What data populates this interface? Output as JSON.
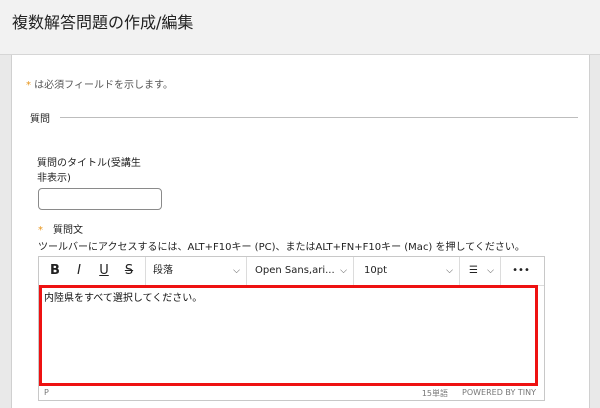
{
  "page": {
    "title": "複数解答問題の作成/編集"
  },
  "required_note": {
    "star": "*",
    "text": " は必須フィールドを示します。"
  },
  "section": {
    "label": "質問"
  },
  "title_field": {
    "label_line1": "質問のタイトル(受講生",
    "label_line2": "非表示)",
    "value": ""
  },
  "question": {
    "star": "*",
    "label": "質問文",
    "hint": "ツールバーにアクセスするには、ALT+F10キー (PC)、またはALT+FN+F10キー (Mac) を押してください。"
  },
  "toolbar": {
    "bold": "B",
    "italic": "I",
    "underline": "U",
    "strike": "S",
    "paragraph": "段落",
    "font": "Open Sans,ari...",
    "size": "10pt",
    "list_glyph": "☰",
    "more": "•••",
    "chevron": "⌵"
  },
  "editor": {
    "content": "内陸県をすべて選択してください。"
  },
  "status": {
    "path": "P",
    "word_count": "15単語",
    "powered_by": "POWERED BY TINY"
  },
  "colors": {
    "highlight": "#ee1111",
    "required_star": "#e8941a"
  }
}
